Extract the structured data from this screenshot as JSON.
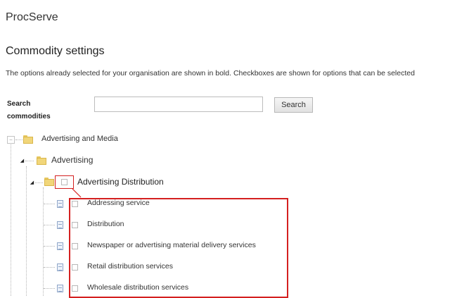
{
  "app": {
    "title": "ProcServe"
  },
  "page": {
    "title": "Commodity settings",
    "intro": "The options already selected for your organisation are shown in bold. Checkboxes are shown for options that can be selected"
  },
  "search": {
    "label": "Search commodities",
    "value": "",
    "button_label": "Search"
  },
  "tree": {
    "root": {
      "label": "Advertising and Media",
      "expanded": true
    },
    "level1": {
      "label": "Advertising",
      "expanded": true
    },
    "level2": {
      "label": "Advertising Distribution",
      "expanded": true,
      "checked": false
    },
    "leaves": [
      {
        "label": "Addressing service",
        "checked": false
      },
      {
        "label": "Distribution",
        "checked": false
      },
      {
        "label": "Newspaper or advertising material delivery services",
        "checked": false
      },
      {
        "label": "Retail distribution services",
        "checked": false
      },
      {
        "label": "Wholesale distribution services",
        "checked": false
      }
    ]
  },
  "annotation": {
    "color": "#d42020"
  },
  "icons": {
    "root_toggle": "minus-box-icon",
    "branch_toggle": "triangle-icon",
    "folder": "folder-icon",
    "leaf": "document-icon"
  }
}
